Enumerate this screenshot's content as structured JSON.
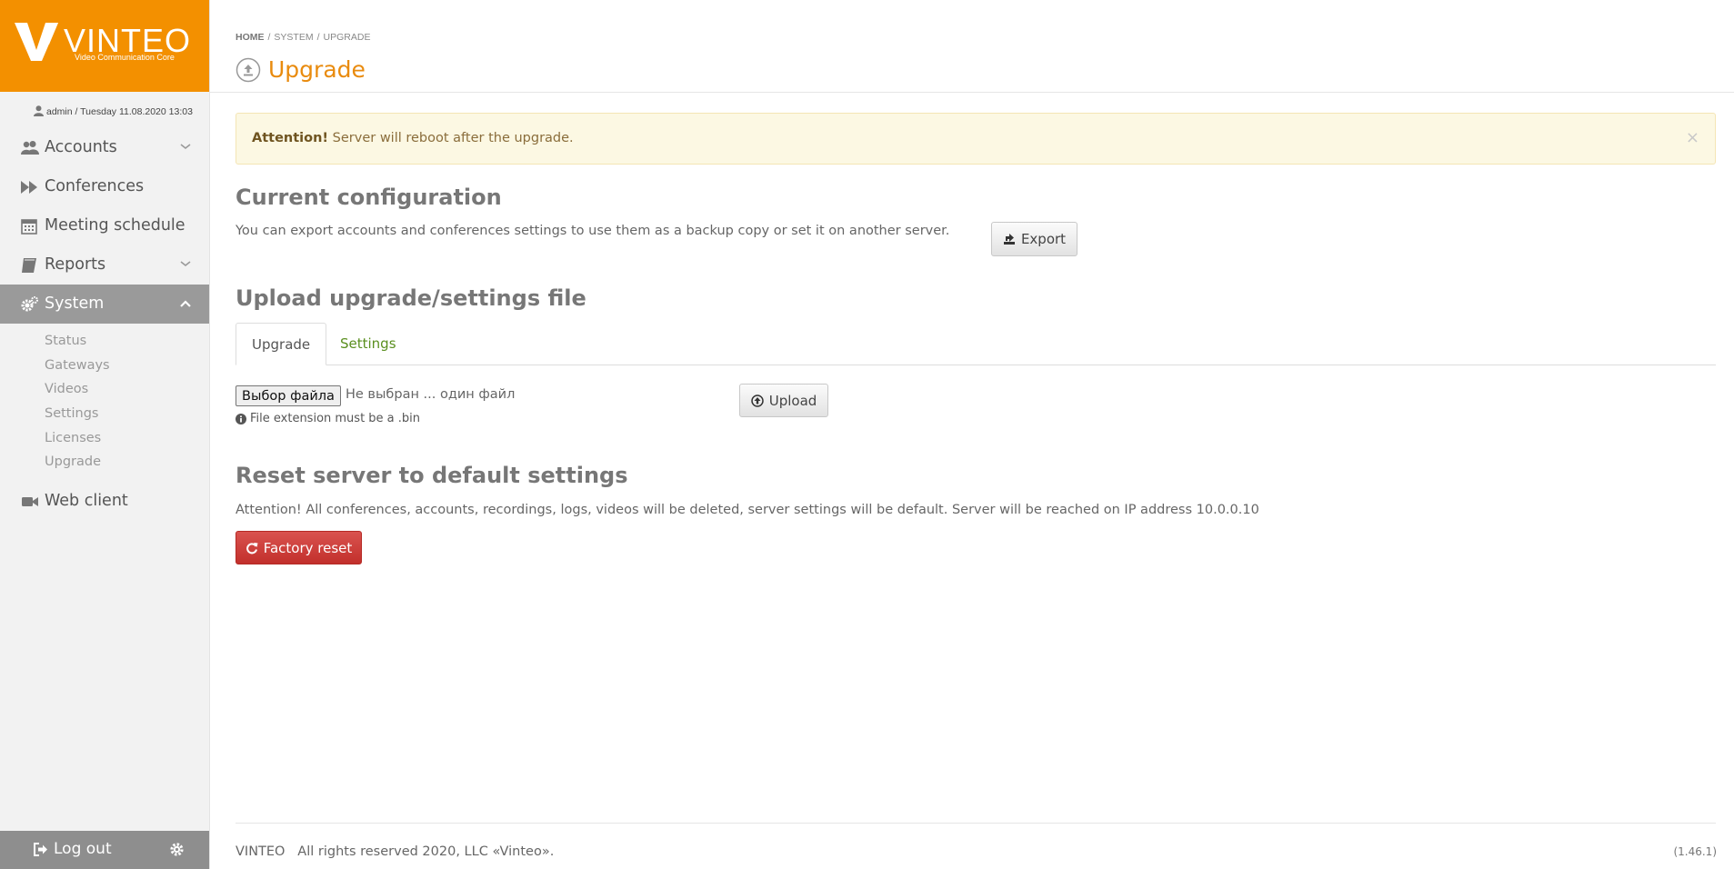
{
  "brand": {
    "name": "VINTEO",
    "tagline": "Video Communication Core",
    "accent_color": "#f39000"
  },
  "user_line": "admin / Tuesday 11.08.2020 13:03",
  "nav": {
    "items": [
      {
        "label": "Accounts",
        "icon": "users-icon",
        "expandable": true
      },
      {
        "label": "Conferences",
        "icon": "fast-forward-icon"
      },
      {
        "label": "Meeting schedule",
        "icon": "calendar-icon"
      },
      {
        "label": "Reports",
        "icon": "book-icon",
        "expandable": true
      },
      {
        "label": "System",
        "icon": "gears-icon",
        "expanded": true,
        "active": true
      },
      {
        "label": "Web client",
        "icon": "video-camera-icon"
      }
    ],
    "system_sub": [
      "Status",
      "Gateways",
      "Videos",
      "Settings",
      "Licenses",
      "Upgrade"
    ],
    "logout_label": "Log out"
  },
  "breadcrumb": [
    "HOME",
    "SYSTEM",
    "UPGRADE"
  ],
  "page_title": "Upgrade",
  "alert": {
    "strong": "Attention!",
    "text": "Server will reboot after the upgrade.",
    "close": "×"
  },
  "current_config": {
    "heading": "Current configuration",
    "description": "You can export accounts and conferences settings to use them as a backup copy or set it on another server.",
    "export_label": "Export"
  },
  "upload": {
    "heading": "Upload upgrade/settings file",
    "tabs": [
      "Upgrade",
      "Settings"
    ],
    "active_tab": "Upgrade",
    "file_button": "Выбор файла",
    "file_status": "Не выбран ... один файл",
    "hint": "File extension must be a .bin",
    "upload_label": "Upload"
  },
  "reset": {
    "heading": "Reset server to default settings",
    "description": "Attention! All conferences, accounts, recordings, logs, videos will be deleted, server settings will be default. Server will be reached on IP address 10.0.0.10",
    "button_label": "Factory reset",
    "button_color": "#d9534f"
  },
  "footer": {
    "text": "VINTEO   All rights reserved 2020, LLC «Vinteo».",
    "version": "(1.46.1)"
  }
}
